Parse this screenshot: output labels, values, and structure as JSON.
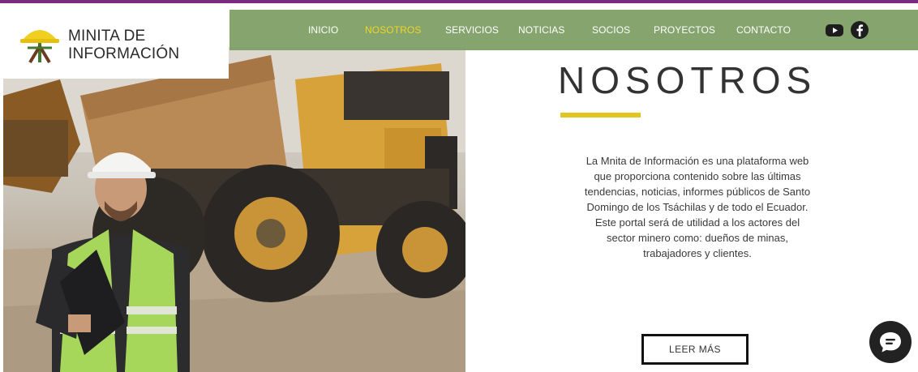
{
  "colors": {
    "accent_purple": "#7a2b7e",
    "nav_green": "#7fa067",
    "active_yellow": "#f1d21b",
    "underline_yellow": "#e3c51f",
    "heading_gray": "#333333"
  },
  "brand": {
    "name_line1": "MINITA DE",
    "name_line2": "INFORMACIÓN",
    "logo_icon": "hardhat-logo-icon"
  },
  "nav": {
    "items": [
      {
        "label": "INICIO",
        "active": false
      },
      {
        "label": "NOSOTROS",
        "active": true
      },
      {
        "label": "SERVICIOS",
        "active": false
      },
      {
        "label": "NOTICIAS",
        "active": false
      },
      {
        "label": "SOCIOS",
        "active": false
      },
      {
        "label": "PROYECTOS",
        "active": false
      },
      {
        "label": "CONTACTO",
        "active": false
      }
    ],
    "social": [
      {
        "icon": "youtube-icon"
      },
      {
        "icon": "facebook-icon"
      }
    ]
  },
  "about": {
    "heading": "NOSOTROS",
    "body": "La Mnita de Información es una plataforma web que proporciona contenido sobre las últimas tendencias, noticias, informes públicos de Santo Domingo de los Tsáchilas y de todo el Ecuador. Este portal será de utilidad a los actores del sector minero como: dueños de minas, trabajadores y clientes.",
    "button_label": "LEER MÁS"
  },
  "chat": {
    "icon": "chat-bubble-icon"
  }
}
